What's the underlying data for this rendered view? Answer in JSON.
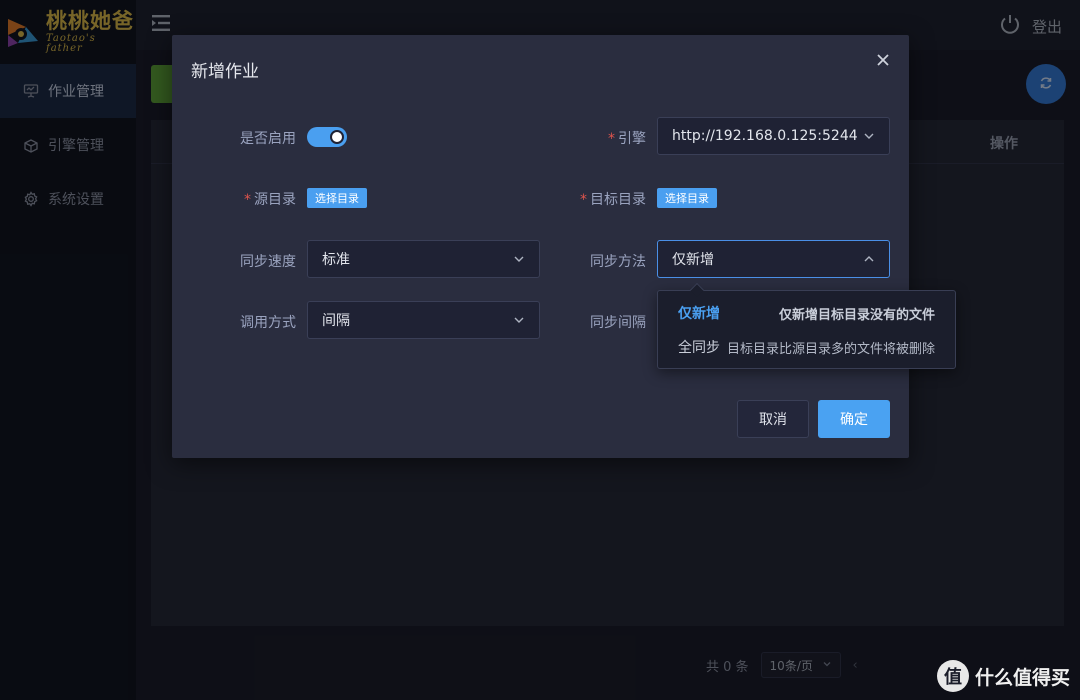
{
  "brand": {
    "name_cn": "桃桃她爸",
    "name_en": "Taotao's father"
  },
  "sidebar": {
    "items": [
      {
        "label": "作业管理",
        "icon": "presentation-board-icon",
        "active": true
      },
      {
        "label": "引擎管理",
        "icon": "engine-box-icon",
        "active": false
      },
      {
        "label": "系统设置",
        "icon": "gear-icon",
        "active": false
      }
    ]
  },
  "topbar": {
    "logout_label": "登出"
  },
  "table": {
    "op_column": "操作"
  },
  "pager": {
    "total": "共 0 条",
    "page_size": "10条/页"
  },
  "modal": {
    "title": "新增作业",
    "fields": {
      "enabled_label": "是否启用",
      "engine_label": "引擎",
      "engine_value": "http://192.168.0.125:5244",
      "source_label": "源目录",
      "source_button": "选择目录",
      "target_label": "目标目录",
      "target_button": "选择目录",
      "speed_label": "同步速度",
      "speed_value": "标准",
      "method_label": "同步方法",
      "method_value": "仅新增",
      "invoke_label": "调用方式",
      "invoke_value": "间隔",
      "interval_label": "同步间隔"
    },
    "method_options": [
      {
        "name": "仅新增",
        "desc": "仅新增目标目录没有的文件",
        "selected": true
      },
      {
        "name": "全同步",
        "desc": "目标目录比源目录多的文件将被删除",
        "selected": false
      }
    ],
    "cancel_label": "取消",
    "ok_label": "确定"
  },
  "watermark": {
    "badge": "值",
    "text": "什么值得买"
  },
  "colors": {
    "accent": "#4a9ff0",
    "required": "#e0554d",
    "add_button": "#5ea23a",
    "brand_gold": "#d9b84a"
  }
}
